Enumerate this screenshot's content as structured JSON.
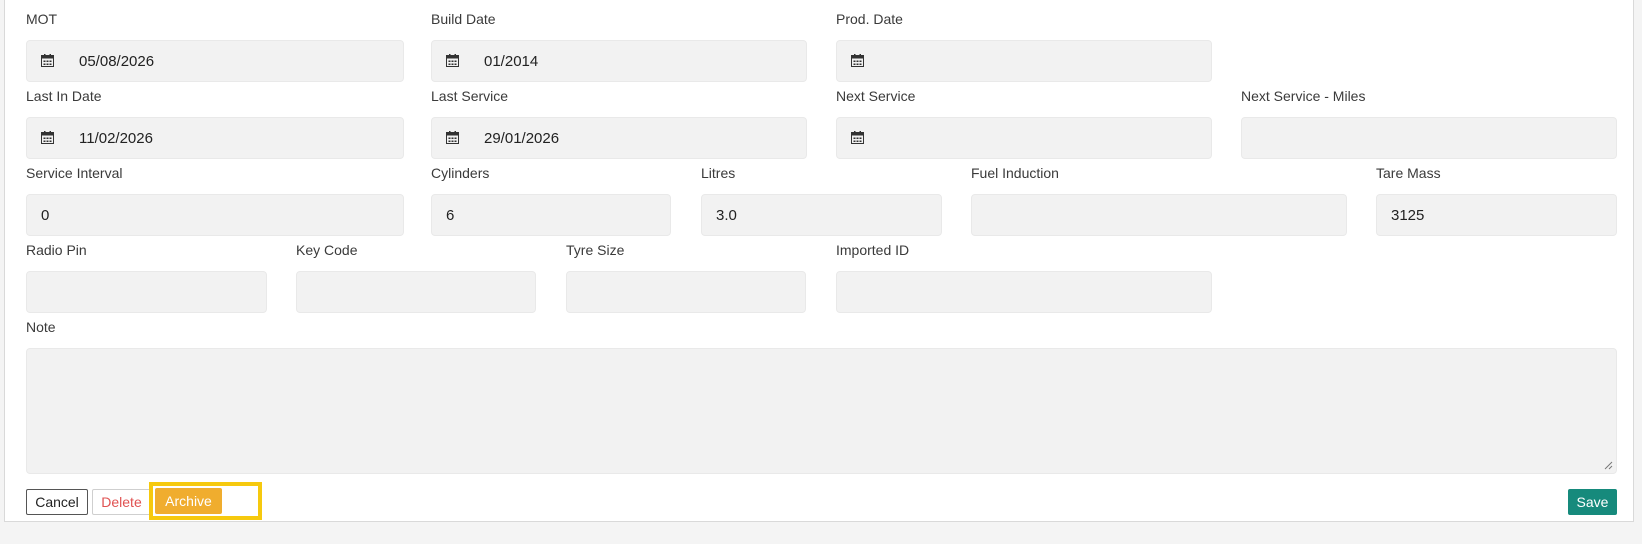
{
  "fields": {
    "mot": {
      "label": "MOT",
      "value": "05/08/2026"
    },
    "build_date": {
      "label": "Build Date",
      "value": "01/2014"
    },
    "prod_date": {
      "label": "Prod. Date",
      "value": ""
    },
    "last_in_date": {
      "label": "Last In Date",
      "value": "11/02/2026"
    },
    "last_service": {
      "label": "Last Service",
      "value": "29/01/2026"
    },
    "next_service": {
      "label": "Next Service",
      "value": ""
    },
    "next_service_miles": {
      "label": "Next Service - Miles",
      "value": ""
    },
    "service_interval": {
      "label": "Service Interval",
      "value": "0"
    },
    "cylinders": {
      "label": "Cylinders",
      "value": "6"
    },
    "litres": {
      "label": "Litres",
      "value": "3.0"
    },
    "fuel_induction": {
      "label": "Fuel Induction",
      "value": ""
    },
    "tare_mass": {
      "label": "Tare Mass",
      "value": "3125"
    },
    "radio_pin": {
      "label": "Radio Pin",
      "value": ""
    },
    "key_code": {
      "label": "Key Code",
      "value": ""
    },
    "tyre_size": {
      "label": "Tyre Size",
      "value": ""
    },
    "imported_id": {
      "label": "Imported ID",
      "value": ""
    },
    "note": {
      "label": "Note",
      "value": ""
    }
  },
  "actions": {
    "cancel": "Cancel",
    "delete": "Delete",
    "archive": "Archive",
    "save": "Save"
  },
  "colors": {
    "archive": "#f0ad2e",
    "highlight": "#f6c90e",
    "save": "#168a7c",
    "delete": "#e05252"
  },
  "icons": {
    "date_field": "calendar-icon",
    "note_resize": "resize-grip-icon"
  }
}
